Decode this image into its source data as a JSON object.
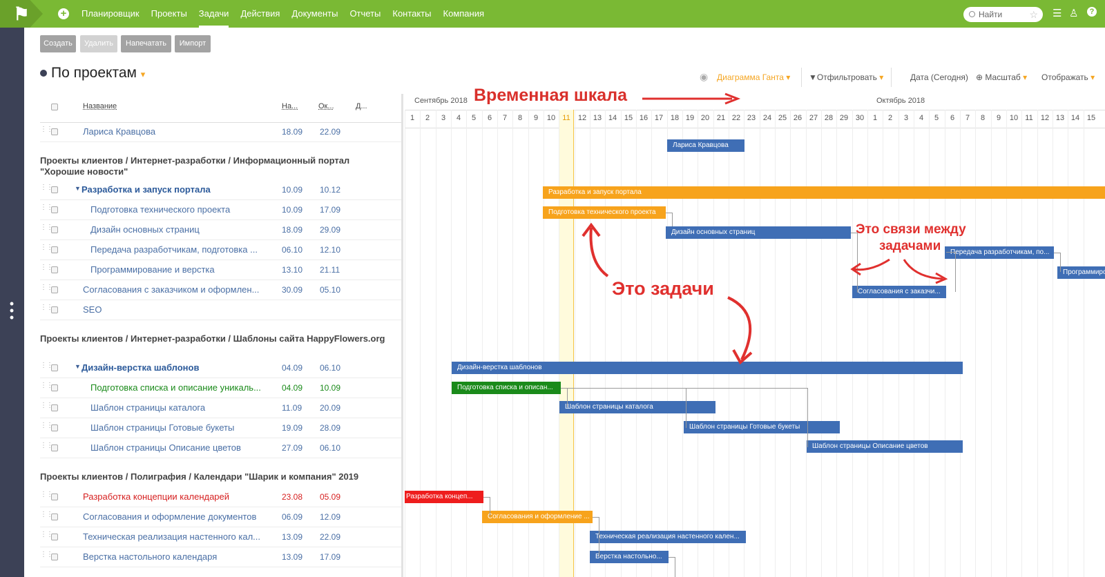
{
  "topbar": {
    "nav": [
      "Планировщик",
      "Проекты",
      "Задачи",
      "Действия",
      "Документы",
      "Отчеты",
      "Контакты",
      "Компания"
    ],
    "active": "Задачи",
    "search_placeholder": "Найти"
  },
  "toolbar": {
    "create": "Создать",
    "delete": "Удалить",
    "print": "Напечатать",
    "import": "Импорт"
  },
  "page_title": "По проектам",
  "gantt_toolbar": {
    "view": "Диаграмма Ганта",
    "filter": "Отфильтровать",
    "date": "Дата (Сегодня)",
    "scale": "Масштаб",
    "display": "Отображать"
  },
  "columns": {
    "name": "Название",
    "start": "На...",
    "end": "Ок...",
    "d": "Д..."
  },
  "groups": [
    {
      "title": ""
    },
    {
      "title": "Проекты клиентов / Интернет-разработки / Информационный портал \"Хорошие новости\""
    },
    {
      "title": "Проекты клиентов / Интернет-разработки / Шаблоны сайта HappyFlowers.org"
    },
    {
      "title": "Проекты клиентов / Полиграфия / Календари \"Шарик и компания\" 2019"
    }
  ],
  "rows": [
    {
      "name": "Лариса Кравцова",
      "start": "18.09",
      "end": "22.09"
    },
    {
      "name": "Разработка и запуск портала",
      "start": "10.09",
      "end": "10.12"
    },
    {
      "name": "Подготовка технического проекта",
      "start": "10.09",
      "end": "17.09"
    },
    {
      "name": "Дизайн основных страниц",
      "start": "18.09",
      "end": "29.09"
    },
    {
      "name": "Передача разработчикам, подготовка ...",
      "start": "06.10",
      "end": "12.10"
    },
    {
      "name": "Программирование и верстка",
      "start": "13.10",
      "end": "21.11"
    },
    {
      "name": "Согласования с заказчиком и оформлен...",
      "start": "30.09",
      "end": "05.10"
    },
    {
      "name": "SEO",
      "start": "",
      "end": ""
    },
    {
      "name": "Дизайн-верстка шаблонов",
      "start": "04.09",
      "end": "06.10"
    },
    {
      "name": "Подготовка списка и описание уникаль...",
      "start": "04.09",
      "end": "10.09"
    },
    {
      "name": "Шаблон страницы каталога",
      "start": "11.09",
      "end": "20.09"
    },
    {
      "name": "Шаблон страницы Готовые букеты",
      "start": "19.09",
      "end": "28.09"
    },
    {
      "name": "Шаблон страницы Описание цветов",
      "start": "27.09",
      "end": "06.10"
    },
    {
      "name": "Разработка концепции календарей",
      "start": "23.08",
      "end": "05.09"
    },
    {
      "name": "Согласования и оформление документов",
      "start": "06.09",
      "end": "12.09"
    },
    {
      "name": "Техническая реализация настенного кал...",
      "start": "13.09",
      "end": "22.09"
    },
    {
      "name": "Верстка настольного календаря",
      "start": "13.09",
      "end": "17.09"
    }
  ],
  "timeline": {
    "months": [
      "Сентябрь 2018",
      "Октябрь 2018"
    ],
    "days": [
      "1",
      "2",
      "3",
      "4",
      "5",
      "6",
      "7",
      "8",
      "9",
      "10",
      "11",
      "12",
      "13",
      "14",
      "15",
      "16",
      "17",
      "18",
      "19",
      "20",
      "21",
      "22",
      "23",
      "24",
      "25",
      "26",
      "27",
      "28",
      "29",
      "30",
      "1",
      "2",
      "3",
      "4",
      "5",
      "6",
      "7",
      "8",
      "9",
      "10",
      "11",
      "12",
      "13",
      "14",
      "15"
    ],
    "today": "11"
  },
  "bars": [
    "Лариса Кравцова",
    "Разработка и запуск портала",
    "Подготовка технического проекта",
    "Дизайн основных страниц",
    "Передача разработчикам, по...",
    "Программиров",
    "Согласования с заказчи...",
    "Дизайн-верстка шаблонов",
    "Подготовка списка и описан...",
    "Шаблон страницы каталога",
    "Шаблон страницы Готовые букеты",
    "Шаблон страницы Описание цветов",
    "Разработка концеп...",
    "Согласования и оформление ...",
    "Техническая реализация настенного кален...",
    "Верстка настольно..."
  ],
  "annotations": {
    "timeline": "Временная шкала",
    "tasks": "Это задачи",
    "links1": "Это связи между",
    "links2": "задачами"
  },
  "colors": {
    "topbar": "#7ab934",
    "bar_blue": "#3f6eb5",
    "bar_orange": "#f7a31c",
    "bar_green": "#1a8a1a",
    "bar_red": "#ee1d1d",
    "annotation": "#e0302e"
  }
}
